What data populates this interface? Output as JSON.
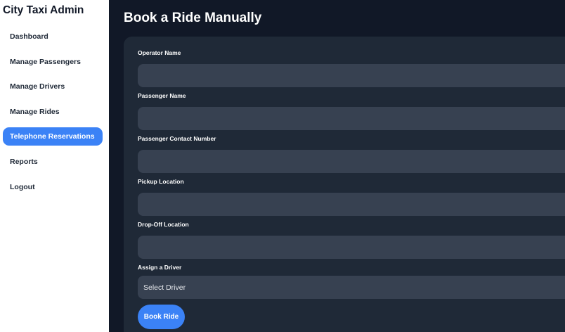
{
  "sidebar": {
    "brand": "City Taxi Admin",
    "items": [
      {
        "label": "Dashboard"
      },
      {
        "label": "Manage Passengers"
      },
      {
        "label": "Manage Drivers"
      },
      {
        "label": "Manage Rides"
      },
      {
        "label": "Telephone Reservations",
        "active": true
      },
      {
        "label": "Reports"
      },
      {
        "label": "Logout"
      }
    ]
  },
  "main": {
    "title": "Book a Ride Manually",
    "form": {
      "operator_name": {
        "label": "Operator Name",
        "value": ""
      },
      "passenger_name": {
        "label": "Passenger Name",
        "value": ""
      },
      "passenger_contact": {
        "label": "Passenger Contact Number",
        "value": ""
      },
      "pickup_location": {
        "label": "Pickup Location",
        "value": ""
      },
      "dropoff_location": {
        "label": "Drop-Off Location",
        "value": ""
      },
      "assign_driver": {
        "label": "Assign a Driver",
        "selected": "Select Driver"
      },
      "submit_label": "Book Ride"
    }
  },
  "colors": {
    "accent": "#3b82f6",
    "page_bg": "#111827",
    "card_bg": "#1f2937",
    "input_bg": "#374151",
    "sidebar_bg": "#ffffff"
  }
}
